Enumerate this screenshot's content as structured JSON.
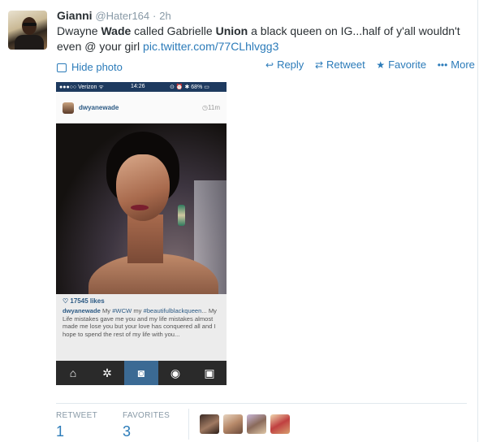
{
  "tweet": {
    "name": "Gianni",
    "handle": "@Hater164",
    "dot": "·",
    "time": "2h",
    "text_1": "Dwayne ",
    "text_bold_1": "Wade",
    "text_2": " called Gabrielle ",
    "text_bold_2": "Union",
    "text_3": " a black queen on IG...half of y'all wouldn't even @ your girl ",
    "link": "pic.twitter.com/77CLhlvgg3",
    "hide_photo": "Hide photo",
    "icons": {
      "avatar": "user-avatar",
      "hide": "photo-icon"
    }
  },
  "actions": {
    "reply": "Reply",
    "retweet": "Retweet",
    "favorite": "Favorite",
    "more": "More",
    "reply_glyph": "↩",
    "retweet_glyph": "⇄",
    "favorite_glyph": "★",
    "more_glyph": "•••"
  },
  "photo": {
    "status": {
      "carrier": "●●●○○ Verizon ᯤ",
      "time": "14:26",
      "right": "⊙ ⏰ ✱ 68% ▭"
    },
    "ig_user": "dwyanewade",
    "ig_age": "◷11m",
    "likes": "♡ 17545 likes",
    "caption_user": "dwyanewade",
    "caption_1": " My ",
    "caption_tag_1": "#WCW",
    "caption_2": " my ",
    "caption_tag_2": "#beautifulblackqueen",
    "caption_3": "... My Life mistakes gave me you and my life mistakes almost made me lose you but your love has conquered all and I hope to spend the rest of my life with you...",
    "nav": [
      "⌂",
      "✲",
      "◙",
      "◉",
      "▣"
    ]
  },
  "stats": {
    "retweet_label": "RETWEET",
    "retweet_count": "1",
    "favorites_label": "FAVORITES",
    "favorites_count": "3"
  },
  "colors": {
    "link": "#2b7bb9",
    "muted": "#8899a6",
    "text": "#292f33"
  }
}
